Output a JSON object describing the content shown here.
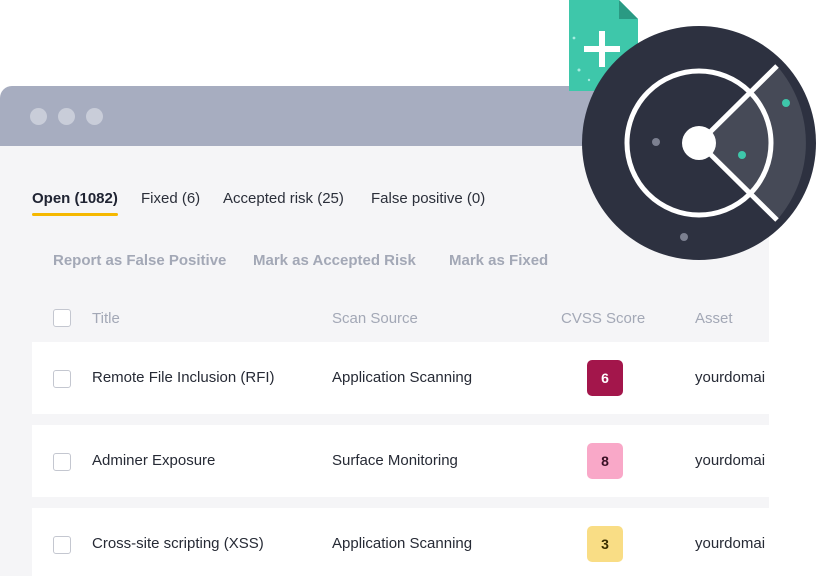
{
  "tabs": [
    {
      "label": "Open (1082)",
      "active": true
    },
    {
      "label": "Fixed (6)",
      "active": false
    },
    {
      "label": "Accepted risk (25)",
      "active": false
    },
    {
      "label": "False positive (0)",
      "active": false
    }
  ],
  "actions": {
    "report_false_positive": "Report as False Positive",
    "mark_accepted_risk": "Mark as Accepted Risk",
    "mark_fixed": "Mark as Fixed"
  },
  "table": {
    "headers": {
      "title": "Title",
      "scan_source": "Scan Source",
      "cvss_score": "CVSS Score",
      "asset": "Asset"
    },
    "rows": [
      {
        "title": "Remote File Inclusion (RFI)",
        "scan_source": "Application Scanning",
        "cvss": "6",
        "asset": "yourdomai",
        "score_bg": "#a3164b",
        "score_fg": "#ffffff"
      },
      {
        "title": "Adminer Exposure",
        "scan_source": "Surface Monitoring",
        "cvss": "8",
        "asset": "yourdomai",
        "score_bg": "#f9a8c8",
        "score_fg": "#3a1025"
      },
      {
        "title": "Cross-site scripting (XSS)",
        "scan_source": "Application Scanning",
        "cvss": "3",
        "asset": "yourdomai",
        "score_bg": "#f9dd85",
        "score_fg": "#3a2e00"
      }
    ]
  },
  "colors": {
    "accent_underline": "#f5b800",
    "titlebar": "#a7adc0",
    "teal": "#3ec7aa",
    "scanner_dark": "#2d3140"
  },
  "icons": {
    "plus_document": "plus-document-icon",
    "radar": "radar-scanner-icon"
  }
}
